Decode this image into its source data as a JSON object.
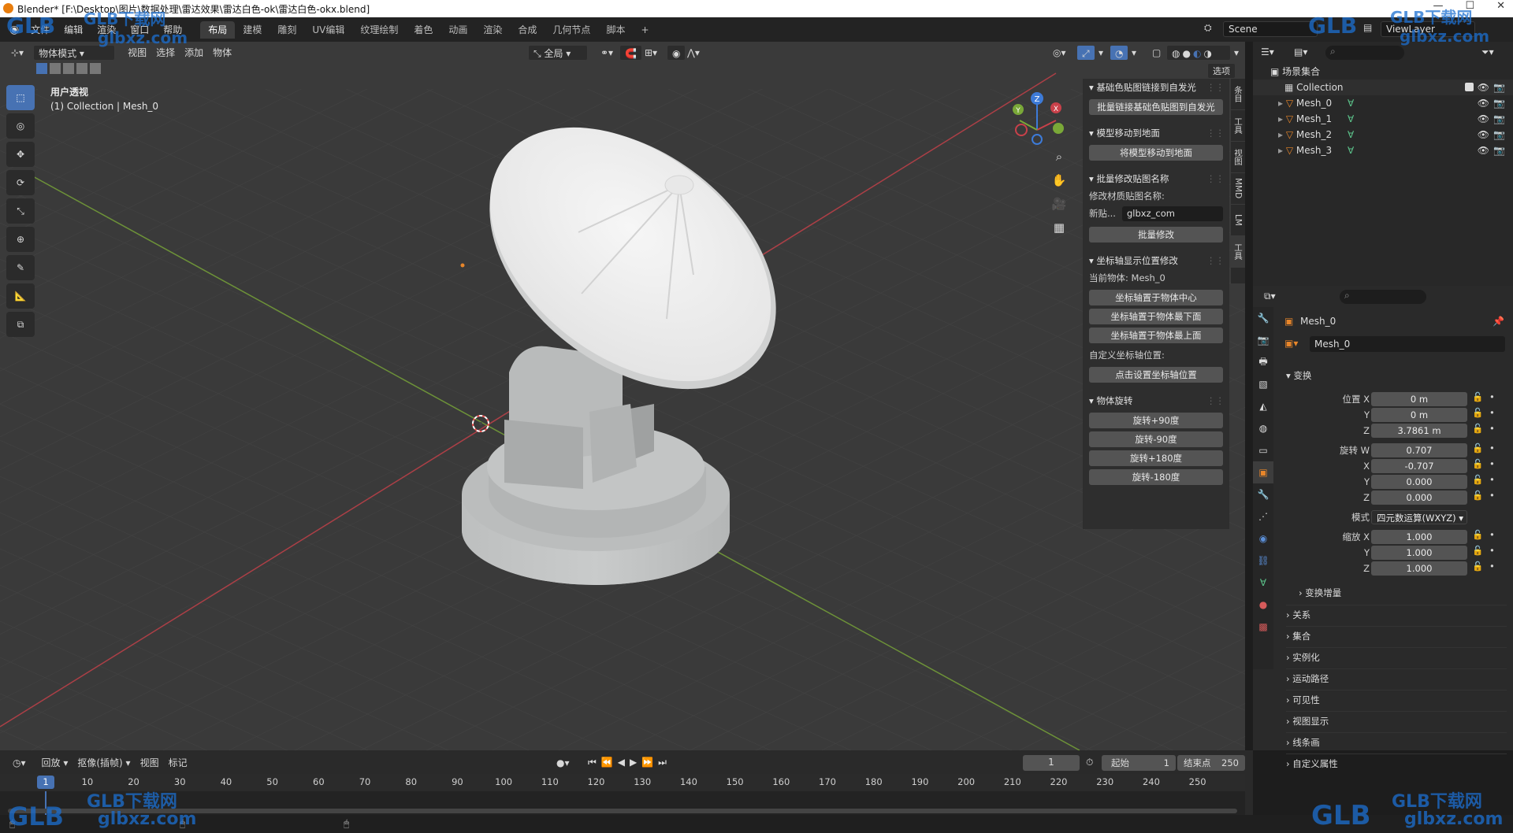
{
  "window": {
    "title": "Blender* [F:\\Desktop\\图片\\数据处理\\雷达效果\\雷达白色-ok\\雷达白色-okx.blend]"
  },
  "menus": [
    "文件",
    "编辑",
    "渲染",
    "窗口",
    "帮助"
  ],
  "workspaces": [
    "布局",
    "建模",
    "雕刻",
    "UV编辑",
    "纹理绘制",
    "着色",
    "动画",
    "渲染",
    "合成",
    "几何节点",
    "脚本"
  ],
  "active_workspace": "布局",
  "scene_field": "Scene",
  "viewlayer_field": "ViewLayer",
  "viewport_header": {
    "mode": "物体模式",
    "menus": [
      "视图",
      "选择",
      "添加",
      "物体"
    ],
    "transform_orientation": "全局",
    "options_label": "选项"
  },
  "viewport_info": {
    "view_name": "用户透视",
    "collection_line": "(1) Collection | Mesh_0"
  },
  "npanel": {
    "sections": {
      "s1_title": "基础色贴图链接到自发光",
      "s1_btn": "批量链接基础色贴图到自发光",
      "s2_title": "模型移动到地面",
      "s2_btn": "将模型移动到地面",
      "s3_title": "批量修改贴图名称",
      "s3_label": "修改材质贴图名称:",
      "s3_new_label": "新贴...",
      "s3_new_value": "glbxz_com",
      "s3_btn": "批量修改",
      "s4_title": "坐标轴显示位置修改",
      "s4_current": "当前物体: Mesh_0",
      "s4_btn1": "坐标轴置于物体中心",
      "s4_btn2": "坐标轴置于物体最下面",
      "s4_btn3": "坐标轴置于物体最上面",
      "s4_custom": "自定义坐标轴位置:",
      "s4_btn4": "点击设置坐标轴位置",
      "s5_title": "物体旋转",
      "s5_btn1": "旋转+90度",
      "s5_btn2": "旋转-90度",
      "s5_btn3": "旋转+180度",
      "s5_btn4": "旋转-180度"
    },
    "tabs": [
      "条目",
      "工具",
      "视图",
      "MMD",
      "LM",
      "工具"
    ]
  },
  "outliner": {
    "root": "场景集合",
    "collection": "Collection",
    "items": [
      "Mesh_0",
      "Mesh_1",
      "Mesh_2",
      "Mesh_3"
    ]
  },
  "properties": {
    "object_name": "Mesh_0",
    "datablock_name": "Mesh_0",
    "transform_title": "变换",
    "location": {
      "label": "位置 X",
      "x": "0 m",
      "y": "0 m",
      "z": "3.7861 m"
    },
    "rotation": {
      "label": "旋转 W",
      "w": "0.707",
      "x": "-0.707",
      "y": "0.000",
      "z": "0.000"
    },
    "mode_label": "模式",
    "mode_value": "四元数运算(WXYZ)",
    "scale": {
      "label": "缩放 X",
      "x": "1.000",
      "y": "1.000",
      "z": "1.000"
    },
    "axis_y": "Y",
    "axis_z": "Z",
    "axis_x": "X",
    "delta": "变换增量",
    "panels": [
      "关系",
      "集合",
      "实例化",
      "运动路径",
      "可见性",
      "视图显示",
      "线条画",
      "自定义属性"
    ]
  },
  "timeline": {
    "menus": [
      "回放",
      "抠像(插帧)",
      "视图",
      "标记"
    ],
    "current_frame": "1",
    "start_label": "起始",
    "start": "1",
    "end_label": "结束点",
    "end": "250",
    "ticks": [
      "1",
      "10",
      "20",
      "30",
      "40",
      "50",
      "60",
      "70",
      "80",
      "90",
      "100",
      "110",
      "120",
      "130",
      "140",
      "150",
      "160",
      "170",
      "180",
      "190",
      "200",
      "210",
      "220",
      "230",
      "240",
      "250"
    ]
  },
  "watermark": {
    "brand": "GLB下载网",
    "url": "glbxz.com",
    "logo": "GLB"
  },
  "colors": {
    "accent": "#4772b3",
    "x_axis": "#c9414a",
    "y_axis": "#7aa838",
    "z_axis": "#3d7bd8",
    "object_orange": "#e8862a"
  }
}
